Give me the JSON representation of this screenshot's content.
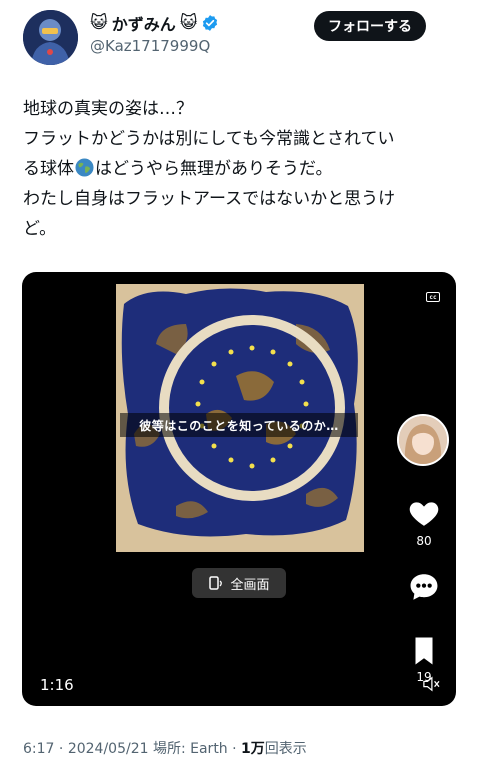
{
  "user": {
    "display_name": "かずみん",
    "name_emoji_left": "😺",
    "name_emoji_right": "😺",
    "handle": "@Kaz1717999Q",
    "verified_icon": "verified-badge-icon",
    "follow_label": "フォローする"
  },
  "tweet": {
    "line1": "地球の真実の姿は…？",
    "line2": "フラットかどうかは別にしても今常識とされてい",
    "line3a": "る球体",
    "line3b": "はどうやら無理がありそうだ。",
    "line4": "わたし自身はフラットアースではないかと思うけ",
    "line5": "ど。"
  },
  "video": {
    "caption": "彼等はこのことを知っているのか…",
    "cc_label": "cc",
    "like_count": "80",
    "share_count": "19",
    "fullscreen_label": "全画面",
    "duration": "1:16"
  },
  "meta": {
    "time": "6:17",
    "sep1": "·",
    "date": "2024/05/21",
    "location": "場所: Earth",
    "sep2": "·",
    "views_count": "1万",
    "views_label": "回表示"
  }
}
